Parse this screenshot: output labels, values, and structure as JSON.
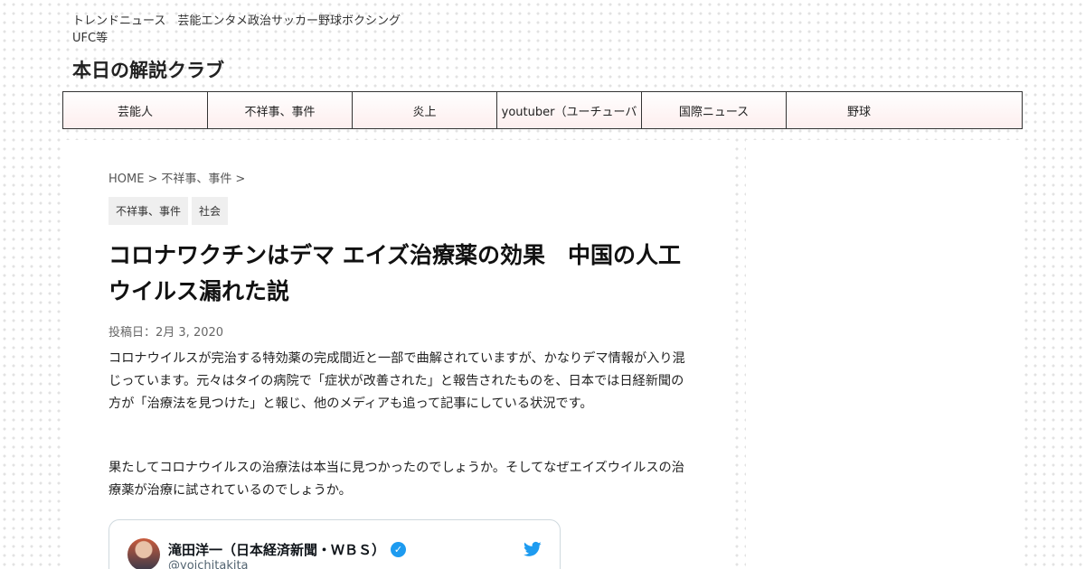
{
  "header": {
    "tagline": "トレンドニュース　芸能エンタメ政治サッカー野球ボクシングUFC等",
    "site_title": "本日の解説クラブ"
  },
  "nav": {
    "items": [
      {
        "label": "芸能人"
      },
      {
        "label": "不祥事、事件"
      },
      {
        "label": "炎上"
      },
      {
        "label": "youtuber（ユーチューバ"
      },
      {
        "label": "国際ニュース"
      },
      {
        "label": "野球"
      }
    ]
  },
  "breadcrumb": {
    "home": "HOME",
    "sep1": ">",
    "category": "不祥事、事件",
    "sep2": ">"
  },
  "categories": [
    "不祥事、事件",
    "社会"
  ],
  "post": {
    "title": "コロナワクチンはデマ エイズ治療薬の効果　中国の人工ウイルス漏れた説",
    "date": "投稿日：2月 3, 2020",
    "paragraph1": "コロナウイルスが完治する特効薬の完成間近と一部で曲解されていますが、かなりデマ情報が入り混じっています。元々はタイの病院で「症状が改善された」と報告されたものを、日本では日経新聞の方が「治療法を見つけた」と報じ、他のメディアも追って記事にしている状況です。",
    "paragraph2": "果たしてコロナウイルスの治療法は本当に見つかったのでしょうか。そしてなぜエイズウイルスの治療薬が治療に試されているのでしょうか。"
  },
  "tweet": {
    "name": "滝田洋一（日本経済新聞・ＷＢＳ）",
    "handle": "@yoichitakita",
    "verified_glyph": "✓",
    "brand_color": "#1d9bf0"
  }
}
